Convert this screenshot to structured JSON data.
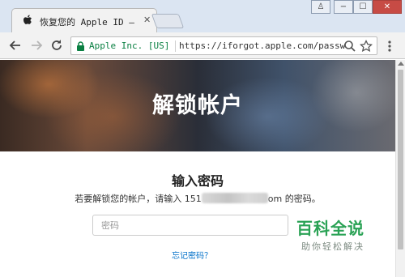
{
  "browser": {
    "tab": {
      "title": "恢复您的 Apple ID – Apple (中国)",
      "close_glyph": "✕"
    },
    "window_controls": {
      "user_glyph": "♙",
      "minimize_glyph": "−",
      "maximize_glyph": "☐",
      "close_glyph": "✕"
    },
    "address_bar": {
      "secure_label": "Apple Inc. [US]",
      "url": "https://iforgot.apple.com/password/verify/appleid"
    },
    "icons": [
      "back-arrow-icon",
      "forward-arrow-icon",
      "reload-icon",
      "lock-icon",
      "zoom-icon",
      "star-icon",
      "menu-icon"
    ]
  },
  "page": {
    "hero_title": "解锁帐户",
    "heading": "输入密码",
    "description_before": "若要解锁您的帐户，请输入 151",
    "description_after": "om 的密码。",
    "password_placeholder": "密码",
    "forgot_link": "忘记密码？"
  },
  "watermark": {
    "brand": "百科全说",
    "tagline": "助你轻松解决"
  },
  "colors": {
    "secure_green": "#0b8043",
    "link_blue": "#0070c9",
    "watermark_green": "#2aa255"
  }
}
